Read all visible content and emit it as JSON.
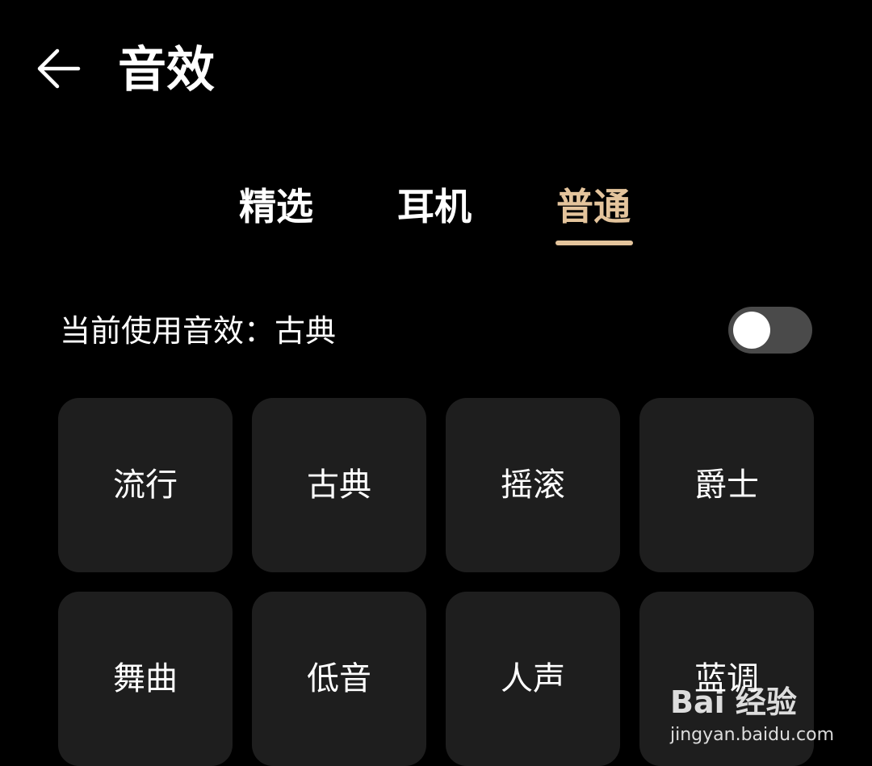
{
  "header": {
    "back_icon": "arrow-left-icon",
    "title": "音效"
  },
  "tabs": [
    {
      "label": "精选",
      "active": false
    },
    {
      "label": "耳机",
      "active": false
    },
    {
      "label": "普通",
      "active": true
    }
  ],
  "current": {
    "label": "当前使用音效：古典",
    "toggle_on": false
  },
  "presets": [
    "流行",
    "古典",
    "摇滚",
    "爵士",
    "舞曲",
    "低音",
    "人声",
    "蓝调"
  ],
  "watermark": {
    "brand": "Bai 经验",
    "url": "jingyan.baidu.com"
  },
  "colors": {
    "background": "#000000",
    "accent": "#e4c49c",
    "tile": "#1e1e1e",
    "toggle_track": "#4a4a4a"
  }
}
